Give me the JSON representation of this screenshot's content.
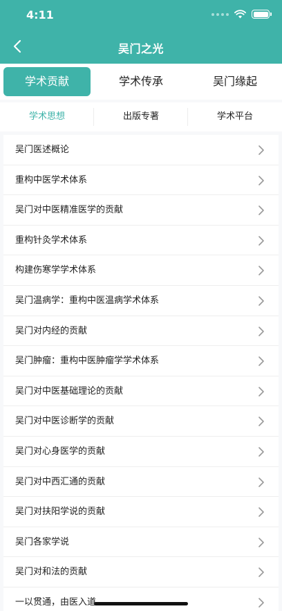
{
  "status_bar": {
    "time": "4:11"
  },
  "nav": {
    "title": "吴门之光"
  },
  "tabs": [
    {
      "label": "学术贡献",
      "active": true
    },
    {
      "label": "学术传承",
      "active": false
    },
    {
      "label": "吴门缘起",
      "active": false
    }
  ],
  "subtabs": [
    {
      "label": "学术思想",
      "active": true
    },
    {
      "label": "出版专著",
      "active": false
    },
    {
      "label": "学术平台",
      "active": false
    }
  ],
  "list": {
    "items": [
      "吴门医述概论",
      "重构中医学术体系",
      "吴门对中医精准医学的贡献",
      "重构针灸学术体系",
      "构建伤寒学学术体系",
      "吴门温病学：重构中医温病学术体系",
      "吴门对内经的贡献",
      "吴门肿瘤：重构中医肿瘤学学术体系",
      "吴门对中医基础理论的贡献",
      "吴门对中医诊断学的贡献",
      "吴门对心身医学的贡献",
      "吴门对中西汇通的贡献",
      "吴门对扶阳学说的贡献",
      "吴门各家学说",
      "吴门对和法的贡献",
      "一以贯通，由医入道"
    ]
  },
  "colors": {
    "accent": "#3fb3a9",
    "text": "#222222",
    "background": "#f7f8fa"
  },
  "icons": {
    "back": "chevron-left-icon",
    "row": "chevron-right-icon",
    "wifi": "wifi-icon",
    "battery": "battery-icon",
    "signal": "signal-icon"
  }
}
